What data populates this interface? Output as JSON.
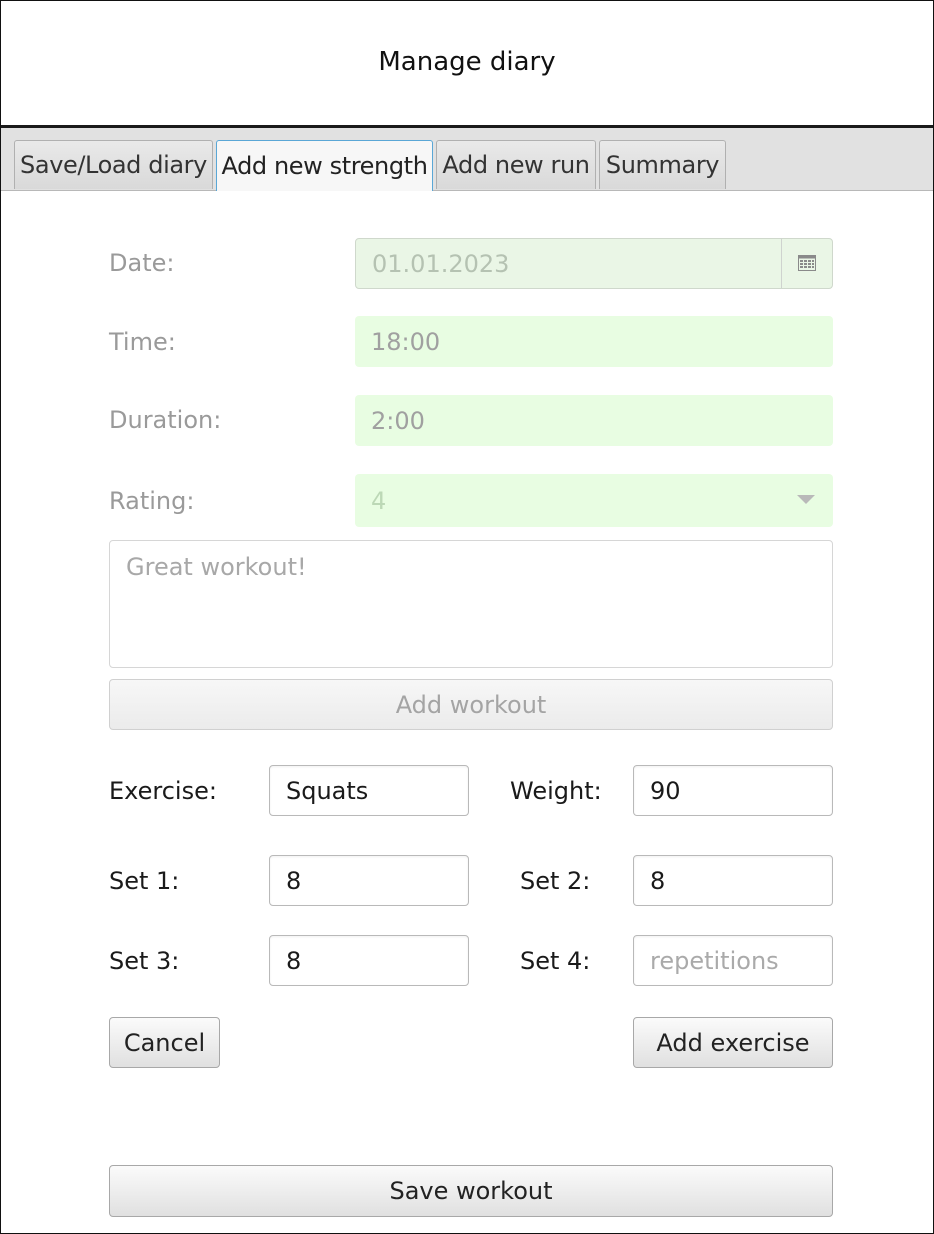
{
  "window": {
    "title": "Manage diary"
  },
  "tabs": [
    {
      "label": "Save/Load diary",
      "active": false
    },
    {
      "label": "Add new strength",
      "active": true
    },
    {
      "label": "Add new run",
      "active": false
    },
    {
      "label": "Summary",
      "active": false
    }
  ],
  "workout": {
    "date_label": "Date:",
    "date_value": "01.01.2023",
    "time_label": "Time:",
    "time_value": "18:00",
    "duration_label": "Duration:",
    "duration_value": "2:00",
    "rating_label": "Rating:",
    "rating_value": "4",
    "notes_value": "Great workout!",
    "add_workout_label": "Add workout"
  },
  "exercise": {
    "exercise_label": "Exercise:",
    "exercise_value": "Squats",
    "weight_label": "Weight:",
    "weight_value": "90",
    "set1_label": "Set 1:",
    "set1_value": "8",
    "set2_label": "Set 2:",
    "set2_value": "8",
    "set3_label": "Set 3:",
    "set3_value": "8",
    "set4_label": "Set 4:",
    "set4_placeholder": "repetitions",
    "cancel_label": "Cancel",
    "add_exercise_label": "Add exercise"
  },
  "footer": {
    "save_label": "Save workout"
  },
  "icons": {
    "date_picker": "calendar-icon",
    "rating_dropdown": "chevron-down-icon"
  },
  "colors": {
    "disabled_field_bg": "#e8fde2",
    "active_tab_border": "#5aa7d6"
  }
}
